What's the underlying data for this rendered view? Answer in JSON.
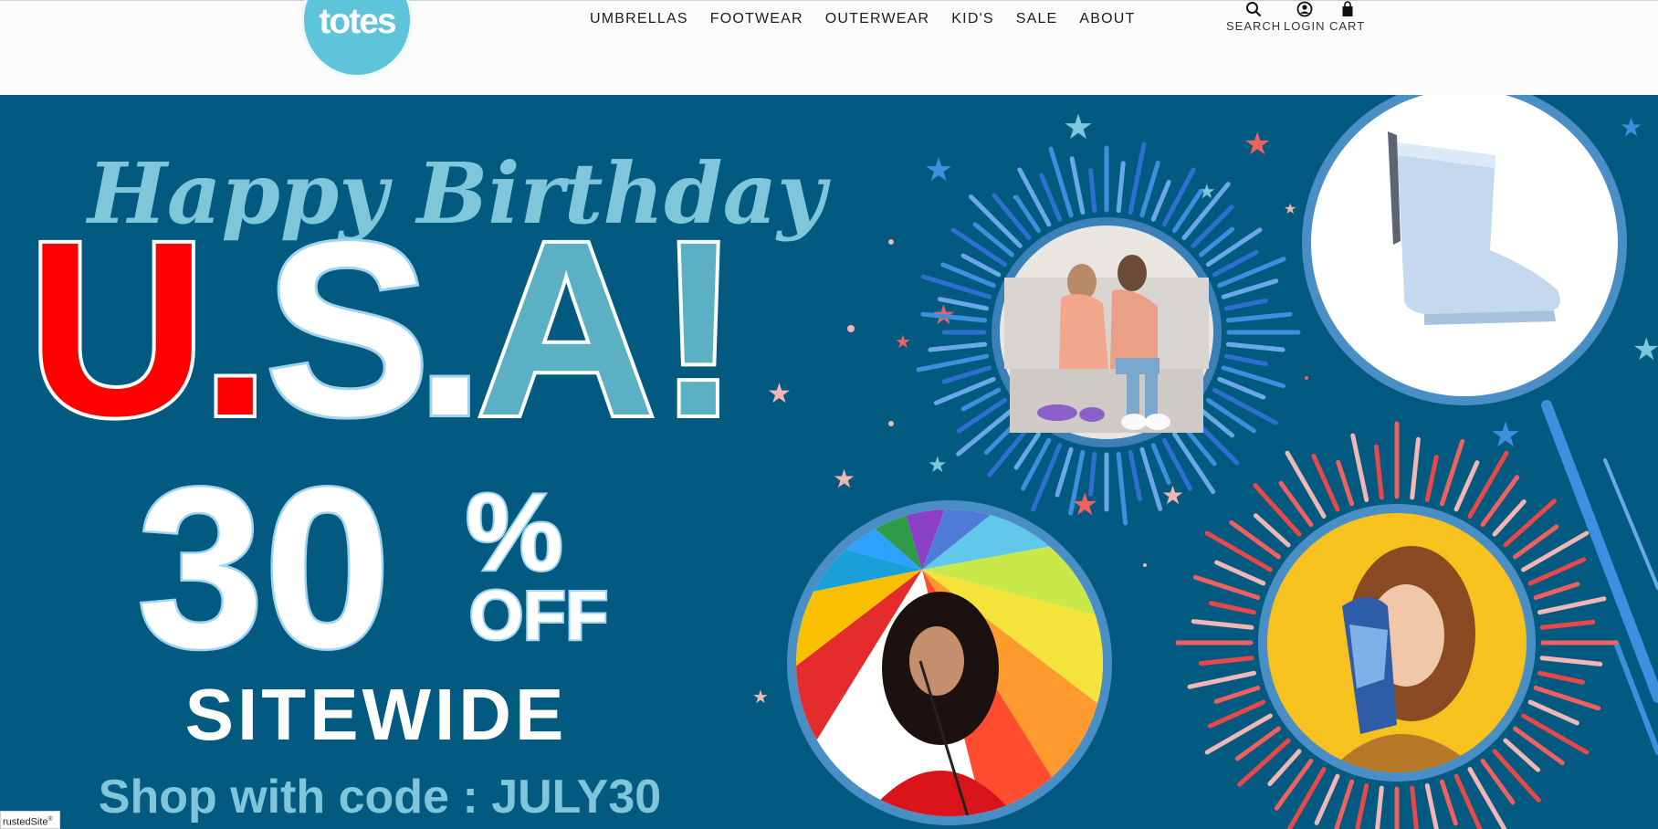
{
  "brand": {
    "logo_text": "totes"
  },
  "nav": {
    "items": [
      {
        "label": "UMBRELLAS"
      },
      {
        "label": "FOOTWEAR"
      },
      {
        "label": "OUTERWEAR"
      },
      {
        "label": "KID'S"
      },
      {
        "label": "SALE"
      },
      {
        "label": "ABOUT"
      }
    ]
  },
  "utility": {
    "search": {
      "label": "SEARCH",
      "icon": "search-icon"
    },
    "login": {
      "label": "LOGIN",
      "icon": "user-icon"
    },
    "cart": {
      "label": "CART",
      "icon": "shopping-bag-icon"
    }
  },
  "hero": {
    "script_title": "Happy Birthday",
    "title_letters": [
      "U",
      ".",
      "S",
      ".",
      "A",
      "!"
    ],
    "discount": "30",
    "discount_pct": "%",
    "discount_off": "OFF",
    "sitewide": "SITEWIDE",
    "promo": "Shop with code : JULY30",
    "colors": {
      "background": "#035a80",
      "red": "#ff0000",
      "teal": "#5bb0c4",
      "light_blue": "#7fc6da",
      "outline": "#9fd3f0"
    }
  },
  "trust_badge": {
    "text": "rustedSite",
    "mark": "®"
  }
}
